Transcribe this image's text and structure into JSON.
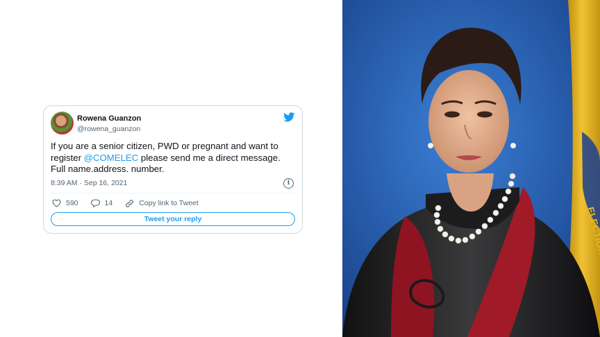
{
  "tweet": {
    "author_name": "Rowena Guanzon",
    "author_handle": "@rowena_guanzon",
    "text_before": "If you are a senior citizen, PWD or pregnant and want to register  ",
    "mention": "@COMELEC",
    "text_after": " please send me a direct message. Full name.address. number.",
    "timestamp": "8:39 AM · Sep 16, 2021",
    "likes": "590",
    "replies": "14",
    "copy_link_label": "Copy link to Tweet",
    "reply_button_label": "Tweet your reply"
  },
  "photo": {
    "description_icon": "portrait-photo",
    "banner_text": "ELECTION"
  },
  "colors": {
    "twitter_blue": "#1d9bf0",
    "photo_background": "#1f5fb5",
    "robe_red": "#8e1421",
    "robe_black": "#1c1c1e",
    "flag_gold": "#e0b21a"
  },
  "icons": [
    "twitter-bird-icon",
    "info-icon",
    "heart-icon",
    "reply-icon",
    "link-icon"
  ]
}
